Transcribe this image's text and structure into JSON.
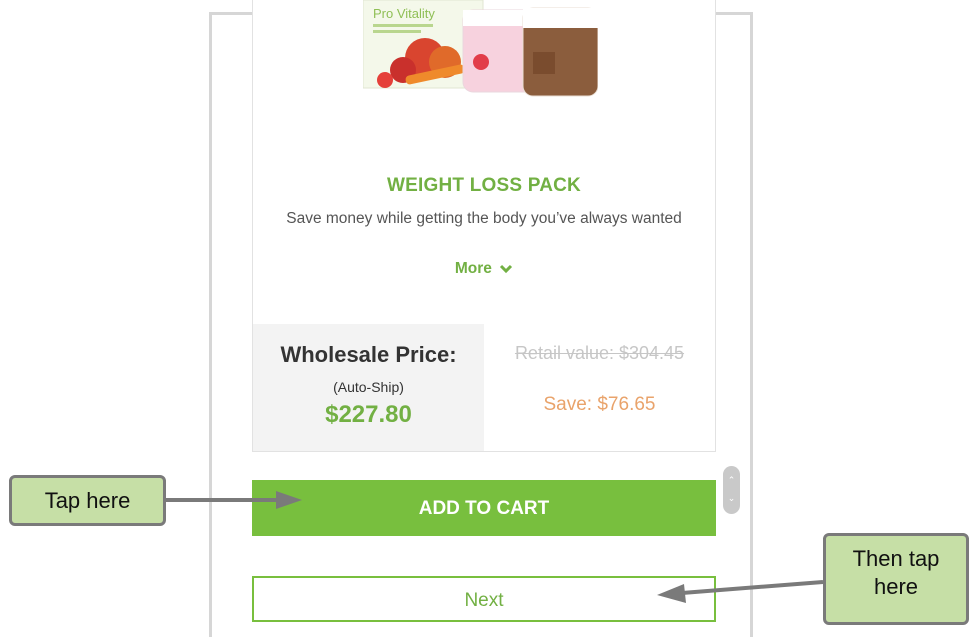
{
  "product": {
    "image_label": "Pro Vitality",
    "title": "WEIGHT LOSS PACK",
    "description": "Save money while getting the body you’ve always wanted",
    "more_label": "More"
  },
  "pricing": {
    "wholesale_label": "Wholesale Price:",
    "wholesale_note": "(Auto-Ship)",
    "wholesale_price": "$227.80",
    "retail_value": "Retail value: $304.45",
    "savings": "Save: $76.65"
  },
  "actions": {
    "add_to_cart_label": "ADD TO CART",
    "next_label": "Next"
  },
  "callouts": {
    "first": "Tap here",
    "second_line1": "Then tap",
    "second_line2": "here"
  },
  "colors": {
    "brand_green": "#78bf3e",
    "callout_fill": "#c6dfa6",
    "savings_orange": "#e9a36b"
  }
}
